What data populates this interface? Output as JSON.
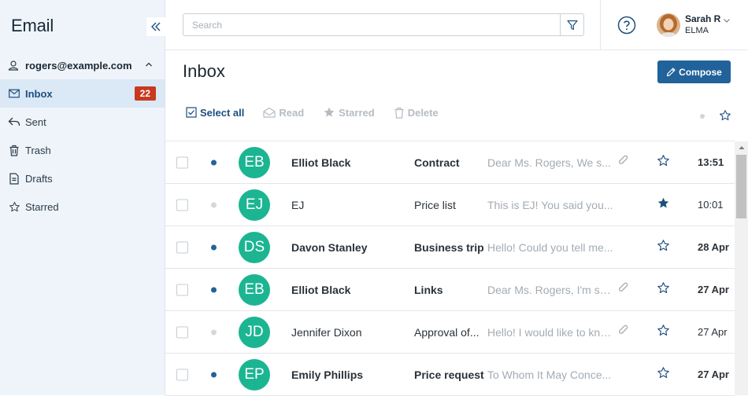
{
  "app": {
    "title": "Email"
  },
  "sidebar": {
    "account": "rogers@example.com",
    "items": [
      {
        "label": "Inbox",
        "icon": "inbox-icon",
        "badge": "22",
        "active": true
      },
      {
        "label": "Sent",
        "icon": "reply-icon"
      },
      {
        "label": "Trash",
        "icon": "trash-icon"
      },
      {
        "label": "Drafts",
        "icon": "document-icon"
      },
      {
        "label": "Starred",
        "icon": "star-icon"
      }
    ]
  },
  "topbar": {
    "search_placeholder": "Search",
    "user": {
      "name": "Sarah R",
      "org": "ELMA"
    }
  },
  "main": {
    "title": "Inbox",
    "compose_label": "Compose",
    "toolbar": {
      "select_all": "Select all",
      "read": "Read",
      "starred": "Starred",
      "delete": "Delete"
    }
  },
  "colors": {
    "accent": "#21629a",
    "avatar": "#1cb592",
    "badge": "#c8391f",
    "sidebar": "#eef4fa"
  },
  "messages": [
    {
      "initials": "EB",
      "sender": "Elliot Black",
      "subject": "Contract",
      "preview": "Dear Ms. Rogers, We s...",
      "attachment": true,
      "starred": false,
      "time": "13:51",
      "unread": true
    },
    {
      "initials": "EJ",
      "sender": "EJ",
      "subject": "Price list",
      "preview": "This is EJ! You said you...",
      "attachment": false,
      "starred": true,
      "time": "10:01",
      "unread": false
    },
    {
      "initials": "DS",
      "sender": "Davon Stanley",
      "subject": "Business trip",
      "preview": "Hello! Could you tell me...",
      "attachment": false,
      "starred": false,
      "time": "28 Apr",
      "unread": true
    },
    {
      "initials": "EB",
      "sender": "Elliot Black",
      "subject": "Links",
      "preview": "Dear Ms. Rogers, I'm se...",
      "attachment": true,
      "starred": false,
      "time": "27 Apr",
      "unread": true
    },
    {
      "initials": "JD",
      "sender": "Jennifer Dixon",
      "subject": "Approval of...",
      "preview": "Hello! I would like to kno...",
      "attachment": true,
      "starred": false,
      "time": "27 Apr",
      "unread": false
    },
    {
      "initials": "EP",
      "sender": "Emily Phillips",
      "subject": "Price request",
      "preview": "To Whom It May Conce...",
      "attachment": false,
      "starred": false,
      "time": "27 Apr",
      "unread": true
    }
  ]
}
